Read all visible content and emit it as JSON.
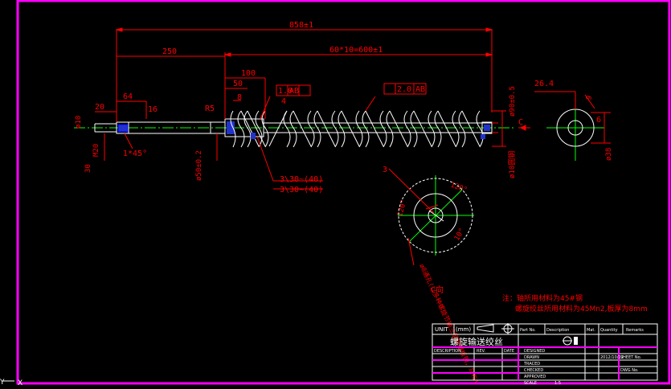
{
  "colors": {
    "background": "#000000",
    "border": "#ff00ff",
    "dimension": "#ff0000",
    "outline": "#ffffff",
    "centerline": "#00ff00",
    "hidden": "#0000ff",
    "yellow": "#ffff00"
  },
  "dims": {
    "overall": "858±1",
    "d250": "250",
    "pitch": "60*10=600±1",
    "d100": "100",
    "d50": "50",
    "d64": "64",
    "d20": "20",
    "d16": "16",
    "d8": "8",
    "r5": "R5",
    "d4": "4",
    "tol1": "1.0",
    "tolA1": "AB",
    "tol2": "2.0",
    "tolA2": "AB",
    "phi90": "ø90±0.5",
    "phi50": "ø50±0.2",
    "phi10": "ø10圆钢",
    "chamfer": "1*45°",
    "d30": "30",
    "m20": "M20",
    "m10": "ø10",
    "d6": "6",
    "d26": "26.4",
    "d9": "9",
    "phi38": "ø38",
    "viewC": "C",
    "d3": "3",
    "weld1": "3\\30~(40)",
    "weld2": "3\\30~(40)",
    "a120a": "120°",
    "a120b": "120°",
    "a10": "10°",
    "hole": "ø8通孔(以多种螺旋节输三层层钢板钢，马布)",
    "viewClabel": "C向"
  },
  "notes": {
    "line1": "注：轴所用材料为45#钢",
    "line2": "螺旋绞丝所用材料为45Mn2,板厚为8mm"
  },
  "titleblock": {
    "unit": "UNIT",
    "unit_val": "(mm)",
    "title": "螺旋输送绞丝",
    "part_no": "Part No.",
    "description": "Description",
    "mat": "Mat.",
    "quantity": "Quantity",
    "remarks": "Remarks",
    "desc_label": "DESCRIPTION",
    "rev": "REV.",
    "date": "DATE",
    "designed": "DESIGNED",
    "drawn": "DRAWN",
    "traced": "TRACED",
    "checked": "CHECKED",
    "approved": "APPROVED",
    "scale": "SCALE",
    "sheet_no": "SHEET No.",
    "scale_val": "1:5",
    "date_val": "2012/10/12",
    "dwg": "DWG No."
  },
  "ucs": {
    "y": "Y",
    "x": "X"
  }
}
